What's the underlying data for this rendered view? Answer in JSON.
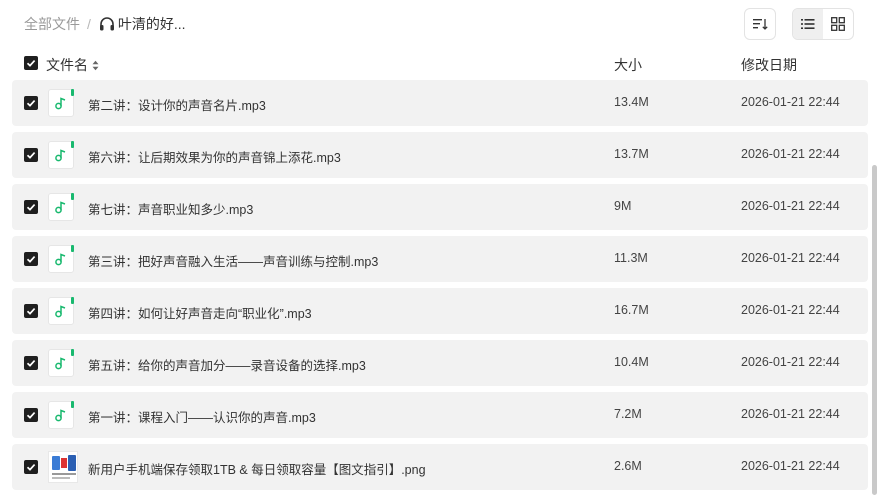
{
  "breadcrumb": {
    "root": "全部文件",
    "separator": "/",
    "current_icon": "headphones-icon",
    "current": "叶清的好..."
  },
  "toolbar": {
    "sort_icon": "sort-list-icon",
    "view_list_icon": "list-view-icon",
    "view_grid_icon": "grid-view-icon",
    "active_view": "list"
  },
  "header": {
    "select_all_checked": true,
    "name": "文件名",
    "size": "大小",
    "modified": "修改日期"
  },
  "files": [
    {
      "name": "第二讲：设计你的声音名片.mp3",
      "size": "13.4M",
      "date": "2026-01-21 22:44",
      "type": "audio",
      "checked": true
    },
    {
      "name": "第六讲：让后期效果为你的声音锦上添花.mp3",
      "size": "13.7M",
      "date": "2026-01-21 22:44",
      "type": "audio",
      "checked": true
    },
    {
      "name": "第七讲：声音职业知多少.mp3",
      "size": "9M",
      "date": "2026-01-21 22:44",
      "type": "audio",
      "checked": true
    },
    {
      "name": "第三讲：把好声音融入生活——声音训练与控制.mp3",
      "size": "11.3M",
      "date": "2026-01-21 22:44",
      "type": "audio",
      "checked": true
    },
    {
      "name": "第四讲：如何让好声音走向“职业化”.mp3",
      "size": "16.7M",
      "date": "2026-01-21 22:44",
      "type": "audio",
      "checked": true
    },
    {
      "name": "第五讲：给你的声音加分——录音设备的选择.mp3",
      "size": "10.4M",
      "date": "2026-01-21 22:44",
      "type": "audio",
      "checked": true
    },
    {
      "name": "第一讲：课程入门——认识你的声音.mp3",
      "size": "7.2M",
      "date": "2026-01-21 22:44",
      "type": "audio",
      "checked": true
    },
    {
      "name": "新用户手机端保存领取1TB & 每日领取容量【图文指引】.png",
      "size": "2.6M",
      "date": "2026-01-21 22:44",
      "type": "image",
      "checked": true
    }
  ],
  "colors": {
    "audio_accent": "#19b96f",
    "checkbox": "#1f1f1f",
    "row_bg": "#f2f2f2"
  }
}
